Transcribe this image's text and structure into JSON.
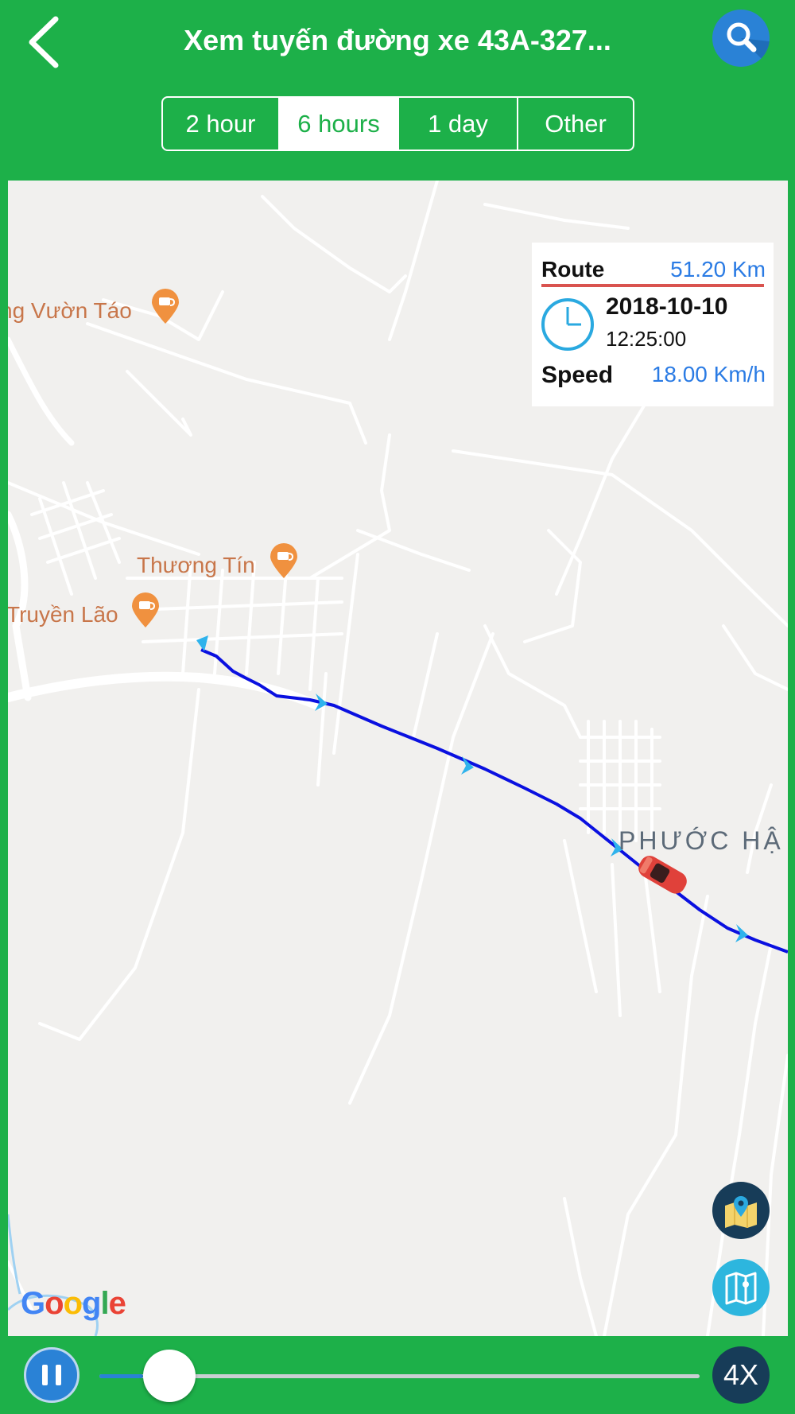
{
  "header": {
    "title": "Xem tuyến đường xe 43A-327...",
    "back_icon": "chevron-left-icon",
    "search_icon": "search-icon"
  },
  "tabs": [
    {
      "label": "2 hour",
      "active": false
    },
    {
      "label": "6 hours",
      "active": true
    },
    {
      "label": "1 day",
      "active": false
    },
    {
      "label": "Other",
      "active": false
    }
  ],
  "map": {
    "pois": [
      {
        "label": "ng Vườn Táo"
      },
      {
        "label": "Thương Tín"
      },
      {
        "label": "Truyền Lão"
      }
    ],
    "area_label": "PHƯỚC HẬ",
    "attribution": "Google",
    "route_color": "#0a10e0",
    "vehicle_icon": "red-car-icon"
  },
  "info": {
    "route_label": "Route",
    "route_value": "51.20 Km",
    "date": "2018-10-10",
    "time": "12:25:00",
    "speed_label": "Speed",
    "speed_value": "18.00 Km/h"
  },
  "controls": {
    "play_icon": "pause-icon",
    "speed_multiplier": "4X",
    "progress": 0.0733,
    "layers_icon": "map-pin-icon",
    "map_type_icon": "map-icon"
  },
  "colors": {
    "primary": "#1db049",
    "accent_blue": "#2a82d6",
    "dark_navy": "#173c58"
  }
}
